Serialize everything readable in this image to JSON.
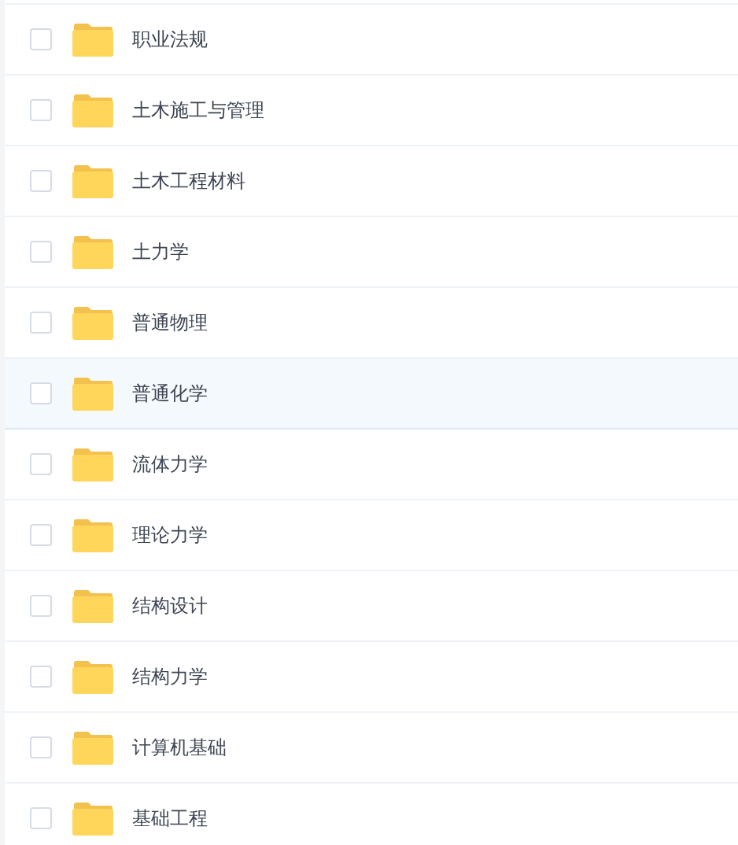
{
  "files": [
    {
      "name": "职业法规",
      "checked": false,
      "highlighted": false
    },
    {
      "name": "土木施工与管理",
      "checked": false,
      "highlighted": false
    },
    {
      "name": "土木工程材料",
      "checked": false,
      "highlighted": false
    },
    {
      "name": "土力学",
      "checked": false,
      "highlighted": false
    },
    {
      "name": "普通物理",
      "checked": false,
      "highlighted": false
    },
    {
      "name": "普通化学",
      "checked": false,
      "highlighted": true
    },
    {
      "name": "流体力学",
      "checked": false,
      "highlighted": false
    },
    {
      "name": "理论力学",
      "checked": false,
      "highlighted": false
    },
    {
      "name": "结构设计",
      "checked": false,
      "highlighted": false
    },
    {
      "name": "结构力学",
      "checked": false,
      "highlighted": false
    },
    {
      "name": "计算机基础",
      "checked": false,
      "highlighted": false
    },
    {
      "name": "基础工程",
      "checked": false,
      "highlighted": false
    }
  ]
}
